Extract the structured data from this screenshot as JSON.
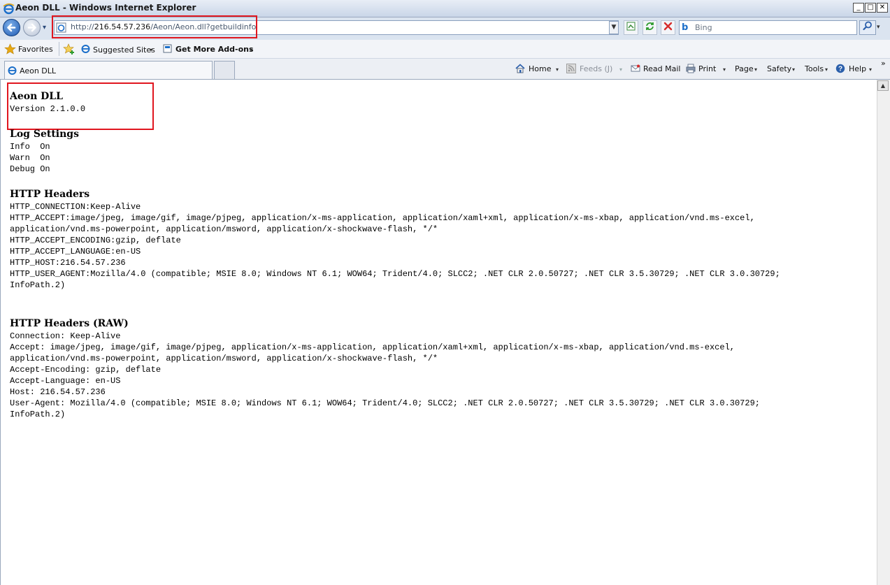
{
  "window": {
    "title": "Aeon DLL - Windows Internet Explorer",
    "min_glyph": "_",
    "max_glyph": "□",
    "close_glyph": "✕"
  },
  "address": {
    "prefix": "http://",
    "host": "216.54.57.236",
    "path": "/Aeon/Aeon.dll?getbuildinfo",
    "dropdown_glyph": "▼"
  },
  "search": {
    "placeholder": "Bing",
    "logo_glyph": "b",
    "go_glyph": "⚲",
    "dropdown_glyph": "▾"
  },
  "favorites": {
    "label": "Favorites",
    "suggested": "Suggested Sites",
    "addons": "Get More Add-ons"
  },
  "tab": {
    "label": "Aeon DLL"
  },
  "commands": {
    "home": "Home",
    "feeds": "Feeds (J)",
    "read_mail": "Read Mail",
    "print": "Print",
    "page": "Page",
    "safety": "Safety",
    "tools": "Tools",
    "help": "Help",
    "dropdown_glyph": "▾",
    "chevron": "»"
  },
  "page": {
    "app_title": "Aeon DLL",
    "version": "Version 2.1.0.0",
    "log_settings_title": "Log Settings",
    "log_settings": "Info  On\nWarn  On\nDebug On",
    "http_headers_title": "HTTP Headers",
    "http_headers": "HTTP_CONNECTION:Keep-Alive\nHTTP_ACCEPT:image/jpeg, image/gif, image/pjpeg, application/x-ms-application, application/xaml+xml, application/x-ms-xbap, application/vnd.ms-excel,\napplication/vnd.ms-powerpoint, application/msword, application/x-shockwave-flash, */*\nHTTP_ACCEPT_ENCODING:gzip, deflate\nHTTP_ACCEPT_LANGUAGE:en-US\nHTTP_HOST:216.54.57.236\nHTTP_USER_AGENT:Mozilla/4.0 (compatible; MSIE 8.0; Windows NT 6.1; WOW64; Trident/4.0; SLCC2; .NET CLR 2.0.50727; .NET CLR 3.5.30729; .NET CLR 3.0.30729;\nInfoPath.2)",
    "http_raw_title": "HTTP Headers (RAW)",
    "http_raw": "Connection: Keep-Alive\nAccept: image/jpeg, image/gif, image/pjpeg, application/x-ms-application, application/xaml+xml, application/x-ms-xbap, application/vnd.ms-excel,\napplication/vnd.ms-powerpoint, application/msword, application/x-shockwave-flash, */*\nAccept-Encoding: gzip, deflate\nAccept-Language: en-US\nHost: 216.54.57.236\nUser-Agent: Mozilla/4.0 (compatible; MSIE 8.0; Windows NT 6.1; WOW64; Trident/4.0; SLCC2; .NET CLR 2.0.50727; .NET CLR 3.5.30729; .NET CLR 3.0.30729;\nInfoPath.2)"
  },
  "icons": {
    "title": "ie-logo-icon",
    "back": "back-arrow-icon",
    "forward": "forward-arrow-icon",
    "compat": "compatibility-view-icon",
    "refresh": "refresh-icon",
    "stop": "stop-icon",
    "search": "search-icon",
    "favorites": "star-icon",
    "home": "home-icon",
    "feeds": "rss-feed-icon",
    "mail": "mail-icon",
    "print": "printer-icon",
    "help": "help-icon"
  },
  "colors": {
    "annotation_red": "#e0161f",
    "ie_blue": "#1b6ec9",
    "favorites_gold": "#e7a813"
  }
}
